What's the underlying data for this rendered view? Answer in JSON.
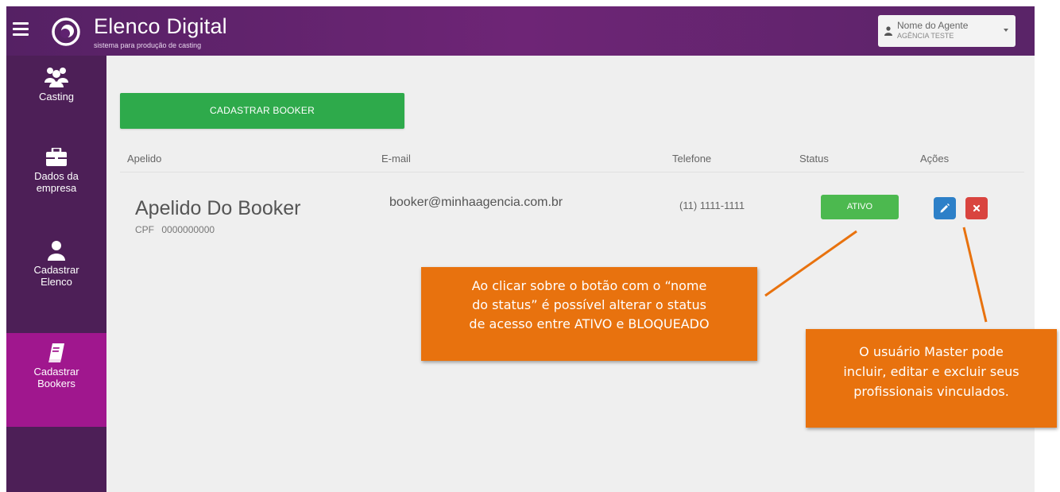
{
  "header": {
    "brand_title": "Elenco Digital",
    "brand_subtitle": "sistema para produção de casting",
    "user_name": "Nome do Agente",
    "user_agency": "AGÊNCIA TESTE"
  },
  "sidebar": {
    "items": [
      {
        "label_lines": [
          "Casting"
        ],
        "icon": "users-group-icon",
        "active": false
      },
      {
        "label_lines": [
          "Dados da",
          "empresa"
        ],
        "icon": "briefcase-icon",
        "active": false
      },
      {
        "label_lines": [
          "Cadastrar",
          "Elenco"
        ],
        "icon": "user-icon",
        "active": false
      },
      {
        "label_lines": [
          "Cadastrar",
          "Bookers"
        ],
        "icon": "book-icon",
        "active": true
      }
    ]
  },
  "main": {
    "register_button_label": "CADASTRAR BOOKER",
    "columns": [
      "Apelido",
      "E-mail",
      "Telefone",
      "Status",
      "Ações"
    ],
    "rows": [
      {
        "nickname": "Apelido Do Booker",
        "cpf_label": "CPF",
        "cpf": "0000000000",
        "email": "booker@minhaagencia.com.br",
        "phone": "(11) 1111-1111",
        "status": "ATIVO"
      }
    ]
  },
  "callouts": {
    "status_note_lines": [
      "Ao clicar sobre o botão com o “nome",
      "do status” é possível alterar o status",
      "de acesso entre ATIVO e BLOQUEADO"
    ],
    "actions_note_lines": [
      "O usuário Master pode",
      "incluir, editar e excluir seus",
      "profissionais vinculados."
    ]
  },
  "colors": {
    "header_purple": "#6e2576",
    "sidebar_purple": "#4d1f57",
    "active_magenta": "#a0178e",
    "success_green": "#2eaa4b",
    "status_green": "#4cb94f",
    "edit_blue": "#2d80c8",
    "delete_red": "#d9443f",
    "callout_orange": "#e8720e"
  }
}
